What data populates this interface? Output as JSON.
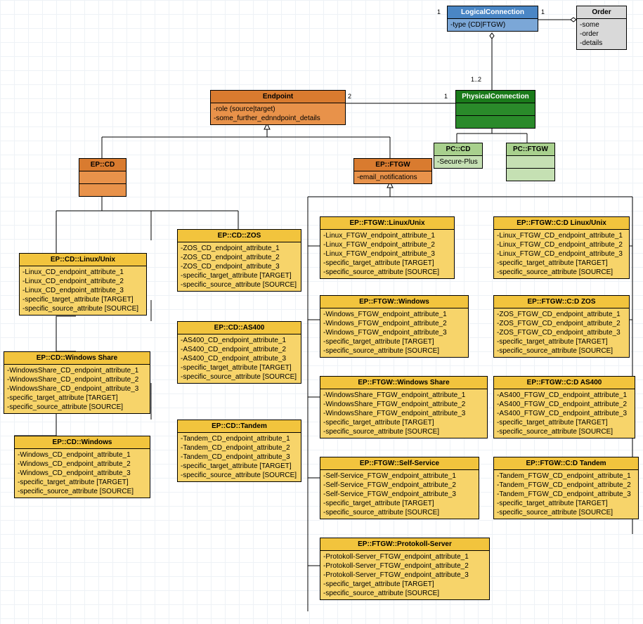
{
  "LogicalConnection": {
    "title": "LogicalConnection",
    "attrs": [
      "-type (CD|FTGW)"
    ]
  },
  "Order": {
    "title": "Order",
    "attrs": [
      "-some",
      "-order",
      "-details"
    ]
  },
  "PhysicalConnection": {
    "title": "PhysicalConnection"
  },
  "Endpoint": {
    "title": "Endpoint",
    "attrs": [
      "-role (source|target)",
      "-some_further_ednndpoint_details"
    ]
  },
  "PC_CD": {
    "title": "PC::CD",
    "attrs": [
      "-Secure-Plus"
    ]
  },
  "PC_FTGW": {
    "title": "PC::FTGW"
  },
  "EP_CD": {
    "title": "EP::CD"
  },
  "EP_FTGW": {
    "title": "EP::FTGW",
    "attrs": [
      "-email_notifications"
    ]
  },
  "EP_CD_Linux": {
    "title": "EP::CD::Linux/Unix",
    "attrs": [
      "-Linux_CD_endpoint_attribute_1",
      "-Linux_CD_endpoint_attribute_2",
      "-Linux_CD_endpoint_attribute_3",
      "-specific_target_attribute [TARGET]",
      "-specific_source_attribute [SOURCE]"
    ]
  },
  "EP_CD_WindowsShare": {
    "title": "EP::CD::Windows Share",
    "attrs": [
      "-WindowsShare_CD_endpoint_attribute_1",
      "-WindowsShare_CD_endpoint_attribute_2",
      "-WindowsShare_CD_endpoint_attribute_3",
      "-specific_target_attribute [TARGET]",
      "-specific_source_attribute [SOURCE]"
    ]
  },
  "EP_CD_Windows": {
    "title": "EP::CD::Windows",
    "attrs": [
      "-Windows_CD_endpoint_attribute_1",
      "-Windows_CD_endpoint_attribute_2",
      "-Windows_CD_endpoint_attribute_3",
      "-specific_target_attribute [TARGET]",
      "-specific_source_attribute [SOURCE]"
    ]
  },
  "EP_CD_ZOS": {
    "title": "EP::CD::ZOS",
    "attrs": [
      "-ZOS_CD_endpoint_attribute_1",
      "-ZOS_CD_endpoint_attribute_2",
      "-ZOS_CD_endpoint_attribute_3",
      "-specific_target_attribute [TARGET]",
      "-specific_source_attribute [SOURCE]"
    ]
  },
  "EP_CD_AS400": {
    "title": "EP::CD::AS400",
    "attrs": [
      "-AS400_CD_endpoint_attribute_1",
      "-AS400_CD_endpoint_attribute_2",
      "-AS400_CD_endpoint_attribute_3",
      "-specific_target_attribute [TARGET]",
      "-specific_source_attribute [SOURCE]"
    ]
  },
  "EP_CD_Tandem": {
    "title": "EP::CD::Tandem",
    "attrs": [
      "-Tandem_CD_endpoint_attribute_1",
      "-Tandem_CD_endpoint_attribute_2",
      "-Tandem_CD_endpoint_attribute_3",
      "-specific_target_attribute [TARGET]",
      "-specific_source_attribute [SOURCE]"
    ]
  },
  "EP_FTGW_Linux": {
    "title": "EP::FTGW::Linux/Unix",
    "attrs": [
      "-Linux_FTGW_endpoint_attribute_1",
      "-Linux_FTGW_endpoint_attribute_2",
      "-Linux_FTGW_endpoint_attribute_3",
      "-specific_target_attribute [TARGET]",
      "-specific_source_attribute [SOURCE]"
    ]
  },
  "EP_FTGW_Windows": {
    "title": "EP::FTGW::Windows",
    "attrs": [
      "-Windows_FTGW_endpoint_attribute_1",
      "-Windows_FTGW_endpoint_attribute_2",
      "-Windows_FTGW_endpoint_attribute_3",
      "-specific_target_attribute [TARGET]",
      "-specific_source_attribute [SOURCE]"
    ]
  },
  "EP_FTGW_WindowsShare": {
    "title": "EP::FTGW::Windows Share",
    "attrs": [
      "-WindowsShare_FTGW_endpoint_attribute_1",
      "-WindowsShare_FTGW_endpoint_attribute_2",
      "-WindowsShare_FTGW_endpoint_attribute_3",
      "-specific_target_attribute [TARGET]",
      "-specific_source_attribute [SOURCE]"
    ]
  },
  "EP_FTGW_SelfService": {
    "title": "EP::FTGW::Self-Service",
    "attrs": [
      "-Self-Service_FTGW_endpoint_attribute_1",
      "-Self-Service_FTGW_endpoint_attribute_2",
      "-Self-Service_FTGW_endpoint_attribute_3",
      "-specific_target_attribute [TARGET]",
      "-specific_source_attribute [SOURCE]"
    ]
  },
  "EP_FTGW_ProtokollServer": {
    "title": "EP::FTGW::Protokoll-Server",
    "attrs": [
      "-Protokoll-Server_FTGW_endpoint_attribute_1",
      "-Protokoll-Server_FTGW_endpoint_attribute_2",
      "-Protokoll-Server_FTGW_endpoint_attribute_3",
      "-specific_target_attribute [TARGET]",
      "-specific_source_attribute [SOURCE]"
    ]
  },
  "EP_FTGW_CD_Linux": {
    "title": "EP::FTGW::C:D Linux/Unix",
    "attrs": [
      "-Linux_FTGW_CD_endpoint_attribute_1",
      "-Linux_FTGW_CD_endpoint_attribute_2",
      "-Linux_FTGW_CD_endpoint_attribute_3",
      "-specific_target_attribute [TARGET]",
      "-specific_source_attribute [SOURCE]"
    ]
  },
  "EP_FTGW_CD_ZOS": {
    "title": "EP::FTGW::C:D ZOS",
    "attrs": [
      "-ZOS_FTGW_CD_endpoint_attribute_1",
      "-ZOS_FTGW_CD_endpoint_attribute_2",
      "-ZOS_FTGW_CD_endpoint_attribute_3",
      "-specific_target_attribute [TARGET]",
      "-specific_source_attribute [SOURCE]"
    ]
  },
  "EP_FTGW_CD_AS400": {
    "title": "EP::FTGW::C:D AS400",
    "attrs": [
      "-AS400_FTGW_CD_endpoint_attribute_1",
      "-AS400_FTGW_CD_endpoint_attribute_2",
      "-AS400_FTGW_CD_endpoint_attribute_3",
      "-specific_target_attribute [TARGET]",
      "-specific_source_attribute [SOURCE]"
    ]
  },
  "EP_FTGW_CD_Tandem": {
    "title": "EP::FTGW::C:D Tandem",
    "attrs": [
      "-Tandem_FTGW_CD_endpoint_attribute_1",
      "-Tandem_FTGW_CD_endpoint_attribute_2",
      "-Tandem_FTGW_CD_endpoint_attribute_3",
      "-specific_target_attribute [TARGET]",
      "-specific_source_attribute [SOURCE]"
    ]
  },
  "mult": {
    "lc_left": "1",
    "lc_right": "1",
    "pc_top": "1..2",
    "pc_ep_left": "2",
    "pc_ep_right": "1"
  }
}
